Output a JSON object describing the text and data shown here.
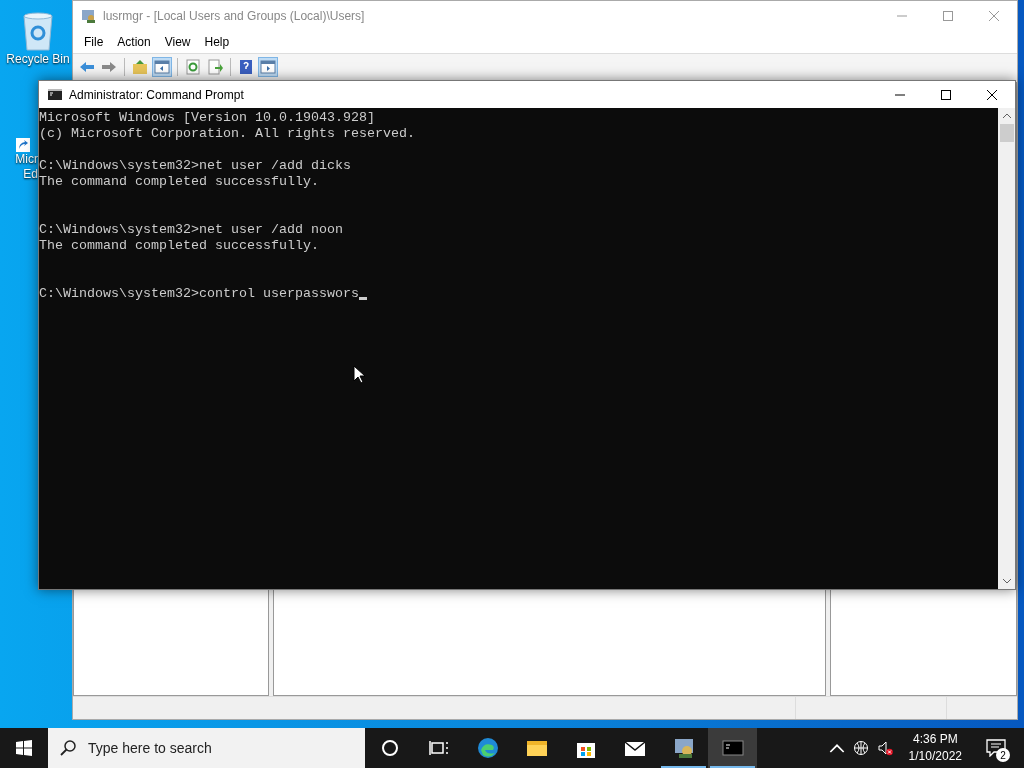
{
  "desktop": {
    "icons": [
      {
        "kind": "recycle-bin",
        "label_lines": [
          "Recycle Bin"
        ]
      },
      {
        "kind": "edge",
        "label_lines": [
          "Micr",
          "Ed"
        ]
      }
    ]
  },
  "mmc_window": {
    "title": "lusrmgr - [Local Users and Groups (Local)\\Users]",
    "menu": [
      "File",
      "Action",
      "View",
      "Help"
    ],
    "toolbar": [
      {
        "kind": "back",
        "pressed": false
      },
      {
        "kind": "forward",
        "pressed": false
      },
      {
        "kind": "separator"
      },
      {
        "kind": "up",
        "pressed": false
      },
      {
        "kind": "tree",
        "pressed": true
      },
      {
        "kind": "separator"
      },
      {
        "kind": "refresh",
        "pressed": false
      },
      {
        "kind": "export",
        "pressed": false
      },
      {
        "kind": "separator"
      },
      {
        "kind": "help",
        "pressed": false
      },
      {
        "kind": "action-pane",
        "pressed": true
      }
    ]
  },
  "cmd_window": {
    "title": "Administrator: Command Prompt",
    "lines": [
      {
        "kind": "text",
        "text": "Microsoft Windows [Version 10.0.19043.928]"
      },
      {
        "kind": "text",
        "text": "(c) Microsoft Corporation. All rights reserved."
      },
      {
        "kind": "blank"
      },
      {
        "kind": "text",
        "text": "C:\\Windows\\system32>net user /add dicks"
      },
      {
        "kind": "text",
        "text": "The command completed successfully."
      },
      {
        "kind": "blank"
      },
      {
        "kind": "blank"
      },
      {
        "kind": "text",
        "text": "C:\\Windows\\system32>net user /add noon"
      },
      {
        "kind": "text",
        "text": "The command completed successfully."
      },
      {
        "kind": "blank"
      },
      {
        "kind": "blank"
      },
      {
        "kind": "prompt",
        "text": "C:\\Windows\\system32>control userpasswors",
        "cursor": true
      }
    ]
  },
  "taskbar": {
    "search": {
      "placeholder": "Type here to search"
    },
    "apps": [
      {
        "kind": "cortana",
        "running": false,
        "selected": false
      },
      {
        "kind": "task-view",
        "running": false,
        "selected": false
      },
      {
        "kind": "edge",
        "running": false,
        "selected": false
      },
      {
        "kind": "explorer",
        "running": false,
        "selected": false
      },
      {
        "kind": "store",
        "running": false,
        "selected": false
      },
      {
        "kind": "mail",
        "running": false,
        "selected": false
      },
      {
        "kind": "users",
        "running": true,
        "selected": false
      },
      {
        "kind": "console",
        "running": true,
        "selected": true
      }
    ],
    "clock": {
      "time": "4:36 PM",
      "date": "1/10/2022"
    },
    "notifications": {
      "count": "2"
    }
  }
}
